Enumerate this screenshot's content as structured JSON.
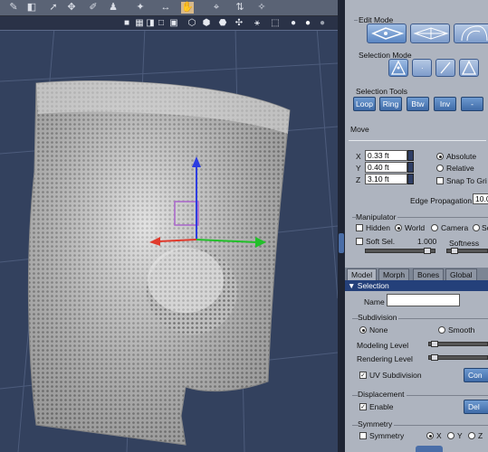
{
  "viewport": {
    "toolbar_top_icons": [
      "figure-icon",
      "cube-icon",
      "arrow-icon",
      "tool-icon",
      "brush-icon",
      "figure-tool-icon",
      "pose-icon",
      "transform-icon",
      "node-icon",
      "target-icon"
    ],
    "toolbar_2_icons": [
      "render-square-icon",
      "wireframe-icon",
      "shading-icon",
      "texture-icon",
      "lit-sphere-icon",
      "shaded-sphere-icon"
    ]
  },
  "panel": {
    "edit_mode": {
      "title": "Edit Mode"
    },
    "selection_mode": {
      "title": "Selection Mode"
    },
    "selection_tools": {
      "title": "Selection Tools",
      "buttons": [
        "Loop",
        "Ring",
        "Btw",
        "Inv",
        "-"
      ]
    },
    "move": {
      "title": "Move",
      "x_label": "X",
      "x_value": "0.33 ft",
      "y_label": "Y",
      "y_value": "0.40 ft",
      "z_label": "Z",
      "z_value": "3.10 ft",
      "absolute": "Absolute",
      "relative": "Relative",
      "snap": "Snap To Gri",
      "edge_propagation_label": "Edge Propagation",
      "edge_propagation_value": "10.0"
    },
    "manipulator": {
      "title": "Manipulator",
      "hidden": "Hidden",
      "world": "World",
      "camera": "Camera",
      "screen": "Sc",
      "soft_sel": "Soft Sel.",
      "soft_sel_value": "1.000",
      "softness": "Softness"
    },
    "tabs": [
      "Model",
      "Morph",
      "Bones",
      "Global"
    ],
    "selection_header": "Selection",
    "name_label": "Name",
    "name_value": "",
    "subdivision": {
      "title": "Subdivision",
      "none": "None",
      "smooth": "Smooth",
      "modeling_level": "Modeling Level",
      "rendering_level": "Rendering Level",
      "uv_subdivision": "UV Subdivision",
      "con_button": "Con"
    },
    "displacement": {
      "title": "Displacement",
      "enable": "Enable",
      "del_button": "Del"
    },
    "symmetry": {
      "title": "Symmetry",
      "symmetry": "Symmetry",
      "x": "X",
      "y": "Y",
      "z": "Z"
    }
  }
}
